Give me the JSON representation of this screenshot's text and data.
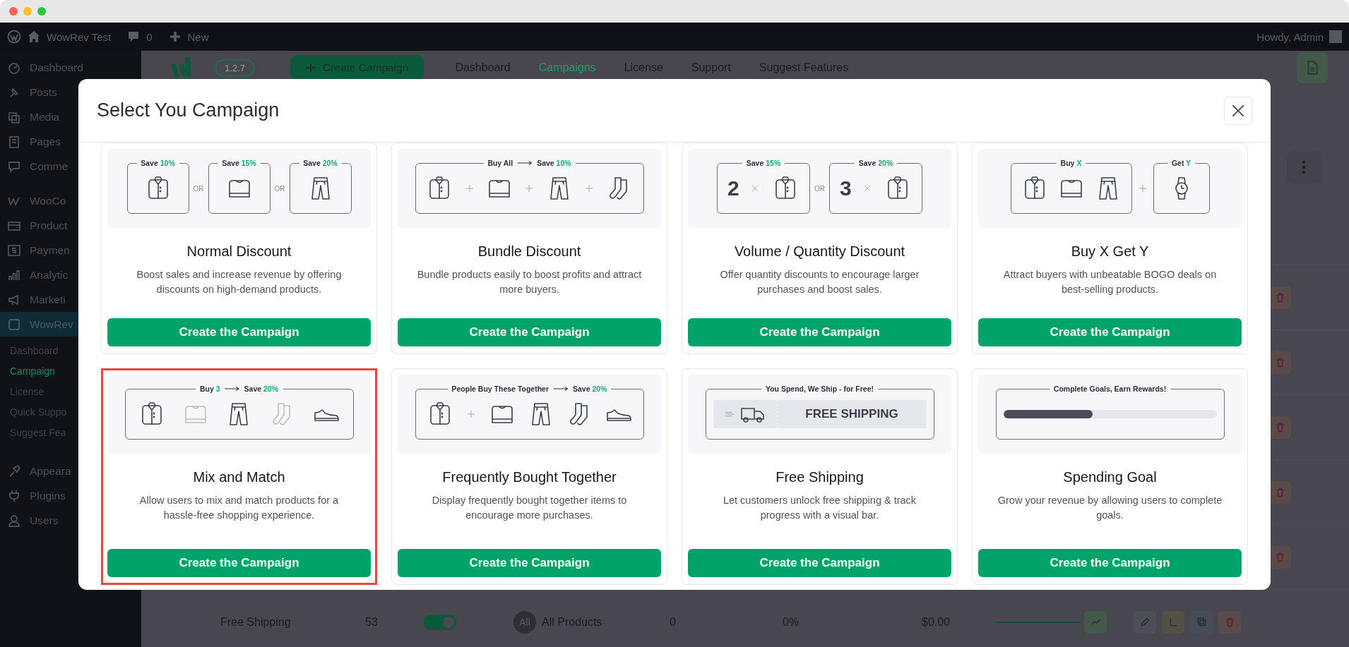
{
  "admin_bar": {
    "site": "WowRev Test",
    "comments": "0",
    "new": "New",
    "greeting": "Howdy, Admin"
  },
  "sidebar": {
    "items": [
      {
        "label": "Dashboard",
        "selected": false
      },
      {
        "label": "Posts",
        "selected": false
      },
      {
        "label": "Media",
        "selected": false
      },
      {
        "label": "Pages",
        "selected": false
      },
      {
        "label": "Comme",
        "selected": false
      },
      {
        "label": "WooCo",
        "selected": false
      },
      {
        "label": "Product",
        "selected": false
      },
      {
        "label": "Paymen",
        "selected": false
      },
      {
        "label": "Analytic",
        "selected": false
      },
      {
        "label": "Marketi",
        "selected": false
      },
      {
        "label": "WowRev",
        "selected": true,
        "children": [
          {
            "label": "Dashboard",
            "selected": false
          },
          {
            "label": "Campaign",
            "selected": true
          },
          {
            "label": "License",
            "selected": false
          },
          {
            "label": "Quick Suppo",
            "selected": false
          },
          {
            "label": "Suggest Fea",
            "selected": false
          }
        ]
      },
      {
        "label": "Appeara",
        "selected": false
      },
      {
        "label": "Plugins",
        "selected": false
      },
      {
        "label": "Users",
        "selected": false
      }
    ]
  },
  "plugin_header": {
    "version": "1.2.7",
    "create_button": "Create Campaign",
    "nav": [
      {
        "label": "Dashboard",
        "selected": false
      },
      {
        "label": "Campaigns",
        "selected": true
      },
      {
        "label": "License",
        "selected": false
      },
      {
        "label": "Support",
        "selected": false
      },
      {
        "label": "Suggest Features",
        "selected": false
      }
    ]
  },
  "table": {
    "rows": [
      {
        "name": "Free Shipping",
        "count": "53",
        "enabled": true,
        "scope_badge": "All",
        "scope": "All Products",
        "column_5": "0",
        "column_6": "0%",
        "column_7": "$0.00"
      }
    ]
  },
  "modal": {
    "title": "Select You Campaign",
    "cards": [
      {
        "title": "Normal Discount",
        "description": "Boost sales and increase revenue by offering discounts on high-demand products.",
        "button": "Create the Campaign",
        "selected": false,
        "illustration": {
          "kind": "choice",
          "separators": [
            "OR",
            "OR"
          ],
          "frames": [
            {
              "label": "Save",
              "accent": "10%"
            },
            {
              "label": "Save",
              "accent": "15%"
            },
            {
              "label": "Save",
              "accent": "20%"
            }
          ]
        }
      },
      {
        "title": "Bundle Discount",
        "description": "Bundle products easily to boost profits and attract more buyers.",
        "button": "Create the Campaign",
        "selected": false,
        "illustration": {
          "kind": "bundle",
          "label": "Buy All",
          "label_2": "Save",
          "accent_2": "10%"
        }
      },
      {
        "title": "Volume / Quantity Discount",
        "description": "Offer quantity discounts to encourage larger purchases and boost sales.",
        "button": "Create the Campaign",
        "selected": false,
        "illustration": {
          "kind": "volume",
          "separators": [
            "OR"
          ],
          "frames": [
            {
              "label": "Save",
              "accent": "15%",
              "quantity": "2"
            },
            {
              "label": "Save",
              "accent": "20%",
              "quantity": "3"
            }
          ]
        }
      },
      {
        "title": "Buy X Get Y",
        "description": "Attract buyers with unbeatable BOGO deals on best-selling products.",
        "button": "Create the Campaign",
        "selected": false,
        "illustration": {
          "kind": "buy_get",
          "frames": [
            {
              "label": "Buy",
              "accent": "X"
            },
            {
              "label": "Get",
              "accent": "Y"
            }
          ]
        }
      },
      {
        "title": "Mix and Match",
        "description": "Allow users to mix and match products for a hassle-free shopping experience.",
        "button": "Create the Campaign",
        "selected": true,
        "illustration": {
          "kind": "mix",
          "label": "Buy",
          "accent": "3",
          "label_2": "Save",
          "accent_2": "20%",
          "items": [
            {
              "dimmed": false
            },
            {
              "dimmed": true
            },
            {
              "dimmed": false
            },
            {
              "dimmed": true
            },
            {
              "dimmed": false
            }
          ]
        }
      },
      {
        "title": "Frequently Bought Together",
        "description": "Display frequently bought together items to encourage more purchases.",
        "button": "Create the Campaign",
        "selected": false,
        "illustration": {
          "kind": "together",
          "label": "People Buy These Together",
          "label_2": "Save",
          "accent_2": "20%"
        }
      },
      {
        "title": "Free Shipping",
        "description": "Let customers unlock free shipping & track progress with a visual bar.",
        "button": "Create the Campaign",
        "selected": false,
        "illustration": {
          "kind": "shipping",
          "label": "You Spend, We Ship - for Free!",
          "banner": "FREE SHIPPING"
        }
      },
      {
        "title": "Spending Goal",
        "description": "Grow your revenue by allowing users to complete goals.",
        "button": "Create the Campaign",
        "selected": false,
        "illustration": {
          "kind": "goal",
          "label": "Complete Goals, Earn Rewards!",
          "level": 0.42
        }
      }
    ]
  }
}
